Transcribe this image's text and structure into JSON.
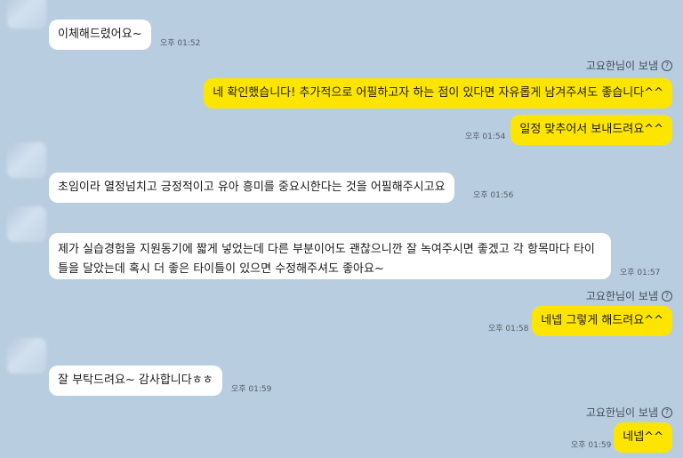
{
  "messages": [
    {
      "text": "이체해드렸어요~",
      "time": "오후 01:52"
    },
    {
      "sender": "고요한님이 보냄",
      "text": "네 확인했습니다! 추가적으로 어필하고자 하는 점이 있다면 자유롭게 남겨주셔도 좋습니다^^"
    },
    {
      "text": "일정 맞추어서 보내드려요^^",
      "time": "오후 01:54"
    },
    {
      "text": "초임이라 열정넘치고 긍정적이고 유아 흥미를 중요시한다는 것을 어필해주시고요",
      "time": "오후 01:56"
    },
    {
      "text": "제가 실습경험을 지원동기에 짧게 넣었는데 다른 부분이어도 괜찮으니깐 잘 녹여주시면 좋겠고 각 항목마다 타이틀을 달았는데 혹시 더 좋은 타이틀이 있으면 수정해주셔도 좋아요~",
      "time": "오후 01:57"
    },
    {
      "sender": "고요한님이 보냄",
      "text": "네넵 그렇게 해드려요^^",
      "time": "오후 01:58"
    },
    {
      "text": "잘 부탁드려요~ 감사합니다ㅎㅎ",
      "time": "오후 01:59"
    },
    {
      "sender": "고요한님이 보냄",
      "text": "네넵^^",
      "time": "오후 01:59"
    }
  ],
  "icons": {
    "help": "question-circle-icon",
    "avatar": "profile-avatar"
  },
  "colors": {
    "background": "#b9cde0",
    "incoming_bubble": "#ffffff",
    "outgoing_bubble": "#fee500"
  }
}
